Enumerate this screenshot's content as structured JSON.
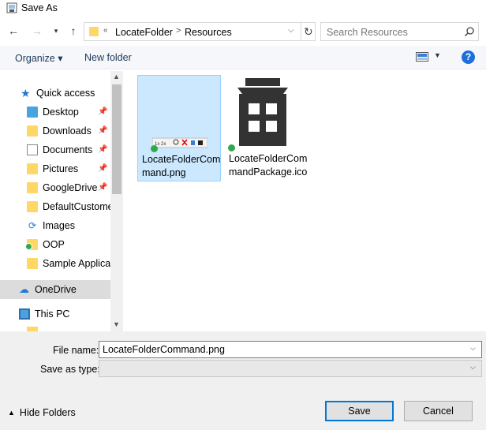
{
  "window": {
    "title": "Save As"
  },
  "address": {
    "overflow": "«",
    "crumbs": [
      "LocateFolder",
      "Resources"
    ],
    "separator": ">"
  },
  "search": {
    "placeholder": "Search Resources"
  },
  "toolbar": {
    "organize_label": "Organize ▾",
    "new_folder_label": "New folder",
    "help_label": "?"
  },
  "nav": {
    "items": [
      {
        "label": "Quick access",
        "icon": "star-icon",
        "pinned": false
      },
      {
        "label": "Desktop",
        "icon": "folder-icon",
        "pinned": true
      },
      {
        "label": "Downloads",
        "icon": "download-icon",
        "pinned": true
      },
      {
        "label": "Documents",
        "icon": "document-icon",
        "pinned": true
      },
      {
        "label": "Pictures",
        "icon": "pictures-icon",
        "pinned": true
      },
      {
        "label": "GoogleDrive",
        "icon": "folder-icon",
        "pinned": true
      },
      {
        "label": "DefaultCustomer",
        "icon": "folder-icon",
        "pinned": false
      },
      {
        "label": "Images",
        "icon": "sync-folder-icon",
        "pinned": false
      },
      {
        "label": "OOP",
        "icon": "synced-folder-icon",
        "pinned": false
      },
      {
        "label": "Sample Applicati",
        "icon": "folder-icon",
        "pinned": false
      },
      {
        "label": "OneDrive",
        "icon": "cloud-icon",
        "pinned": false,
        "selected": true
      },
      {
        "label": "This PC",
        "icon": "computer-icon",
        "pinned": false
      }
    ]
  },
  "files": [
    {
      "name": "LocateFolderCommand.png",
      "selected": true
    },
    {
      "name": "LocateFolderCommandPackage.ico",
      "selected": false
    }
  ],
  "form": {
    "file_name_label": "File name:",
    "file_name_value": "LocateFolderCommand.png",
    "save_type_label": "Save as type:",
    "save_type_value": ""
  },
  "footer": {
    "hide_folders_label": "Hide Folders",
    "save_label": "Save",
    "cancel_label": "Cancel"
  },
  "colors": {
    "selection": "#cce8ff",
    "accent": "#0078d7",
    "folder": "#ffd766"
  }
}
